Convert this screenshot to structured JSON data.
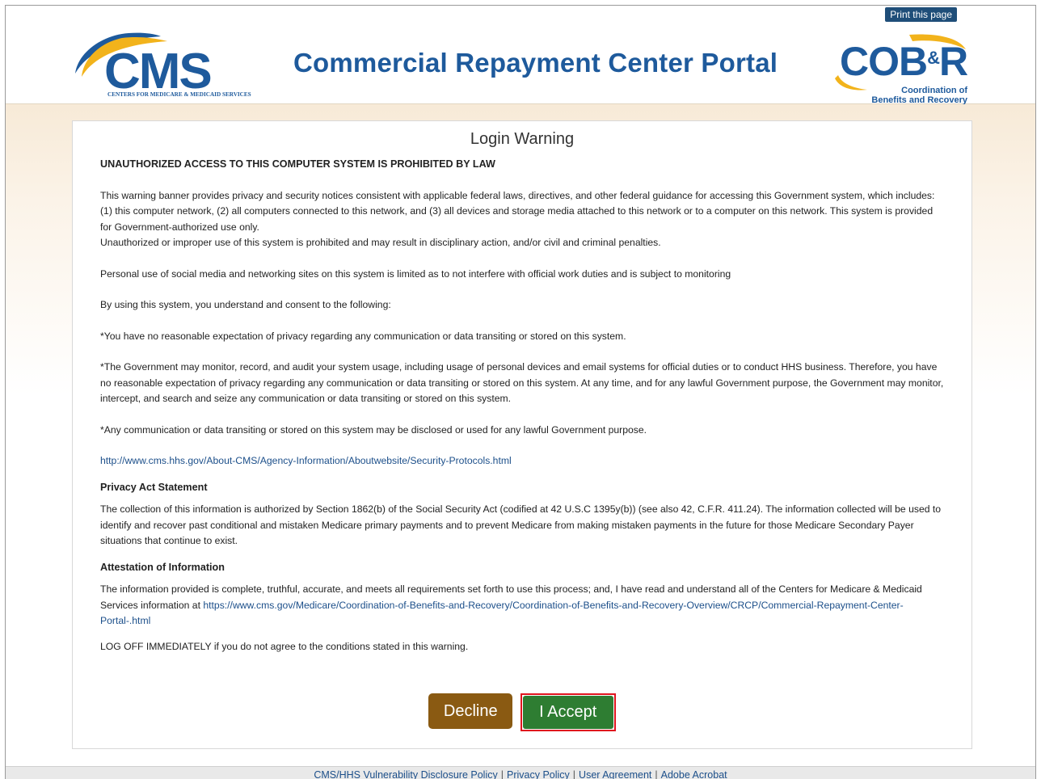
{
  "header": {
    "print_link": "Print this page",
    "portal_title": "Commercial Repayment Center Portal",
    "cms_logo_text": "CMS",
    "cms_logo_subtitle": "CENTERS FOR MEDICARE & MEDICAID SERVICES",
    "cobr_logo_text_a": "COB",
    "cobr_logo_text_amp": "&",
    "cobr_logo_text_r": "R",
    "cobr_line1": "Coordination of",
    "cobr_line2": "Benefits and Recovery"
  },
  "panel": {
    "title": "Login Warning",
    "warning_heading": "UNAUTHORIZED ACCESS TO THIS COMPUTER SYSTEM IS PROHIBITED BY LAW",
    "p1": "This warning banner provides privacy and security notices consistent with applicable federal laws, directives, and other federal guidance for accessing this Government system, which includes: (1) this computer network, (2) all computers connected to this network, and (3) all devices and storage media attached to this network or to a computer on this network. This system is provided for Government-authorized use only.",
    "p1b": "Unauthorized or improper use of this system is prohibited and may result in disciplinary action, and/or civil and criminal penalties.",
    "p2": "Personal use of social media and networking sites on this system is limited as to not interfere with official work duties and is subject to monitoring",
    "p3": "By using this system, you understand and consent to the following:",
    "p4": "*You have no reasonable expectation of privacy regarding any communication or data transiting or stored on this system.",
    "p5": "*The Government may monitor, record, and audit your system usage, including usage of personal devices and email systems for official duties or to conduct HHS business. Therefore, you have no reasonable expectation of privacy regarding any communication or data transiting or stored on this system. At any time, and for any lawful Government purpose, the Government may monitor, intercept, and search and seize any communication or data transiting or stored on this system.",
    "p6": "*Any communication or data transiting or stored on this system may be disclosed or used for any lawful Government purpose.",
    "security_link": "http://www.cms.hhs.gov/About-CMS/Agency-Information/Aboutwebsite/Security-Protocols.html",
    "privacy_heading": "Privacy Act Statement",
    "privacy_text": "The collection of this information is authorized by Section 1862(b) of the Social Security Act (codified at 42 U.S.C 1395y(b)) (see also 42, C.F.R. 411.24). The information collected will be used to identify and recover past conditional and mistaken Medicare primary payments and to prevent Medicare from making mistaken payments in the future for those Medicare Secondary Payer situations that continue to exist.",
    "attestation_heading": "Attestation of Information",
    "attestation_text": "The information provided is complete, truthful, accurate, and meets all requirements set forth to use this process; and, I have read and understand all of the Centers for Medicare & Medicaid Services information at",
    "attestation_link": "https://www.cms.gov/Medicare/Coordination-of-Benefits-and-Recovery/Coordination-of-Benefits-and-Recovery-Overview/CRCP/Commercial-Repayment-Center-Portal-.html",
    "logoff_text": "LOG OFF IMMEDIATELY if you do not agree to the conditions stated in this warning.",
    "decline_label": "Decline",
    "accept_label": "I Accept"
  },
  "footer": {
    "links": [
      "CMS/HHS Vulnerability Disclosure Policy",
      "Privacy Policy",
      "User Agreement",
      "Adobe Acrobat"
    ],
    "separator": "|"
  },
  "colors": {
    "brand_blue": "#1e5a9c",
    "decline": "#8a5a12",
    "accept": "#2e7d32",
    "accept_highlight": "#e0141e",
    "band_tan": "#f7ead7"
  }
}
